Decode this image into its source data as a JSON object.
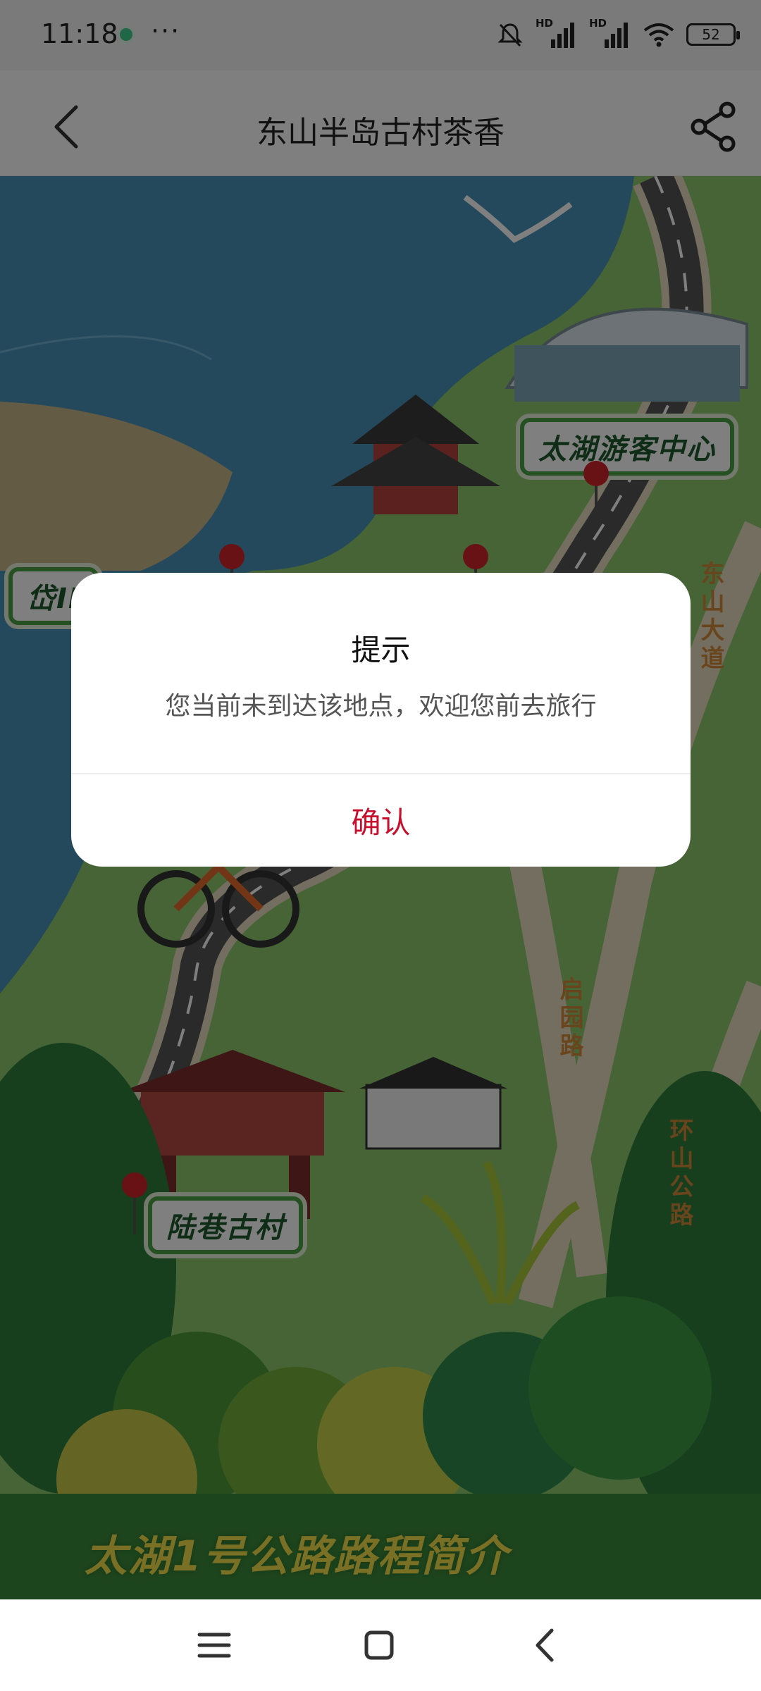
{
  "status_bar": {
    "time": "11:18",
    "more": "···",
    "hd1": "HD",
    "hd2": "HD",
    "battery": "52"
  },
  "header": {
    "title": "东山半岛古村茶香"
  },
  "map": {
    "labels": {
      "visitor_center": "太湖游客中心",
      "left_partial": "岱ⅠⅠ",
      "luxiang": "陆巷古村"
    },
    "roads": {
      "dongshan": "东山大道",
      "qiyuan": "启园路",
      "huanshan": "环山公路"
    },
    "banner": "太湖1号公路路程简介"
  },
  "dialog": {
    "title": "提示",
    "message": "您当前未到达该地点，欢迎您前去旅行",
    "confirm": "确认",
    "confirm_color": "#c8102e"
  },
  "icons": {
    "back": "back-chevron-icon",
    "share": "share-icon",
    "nav_menu": "menu-icon",
    "nav_home": "home-square-icon",
    "nav_back": "back-triangle-icon"
  }
}
